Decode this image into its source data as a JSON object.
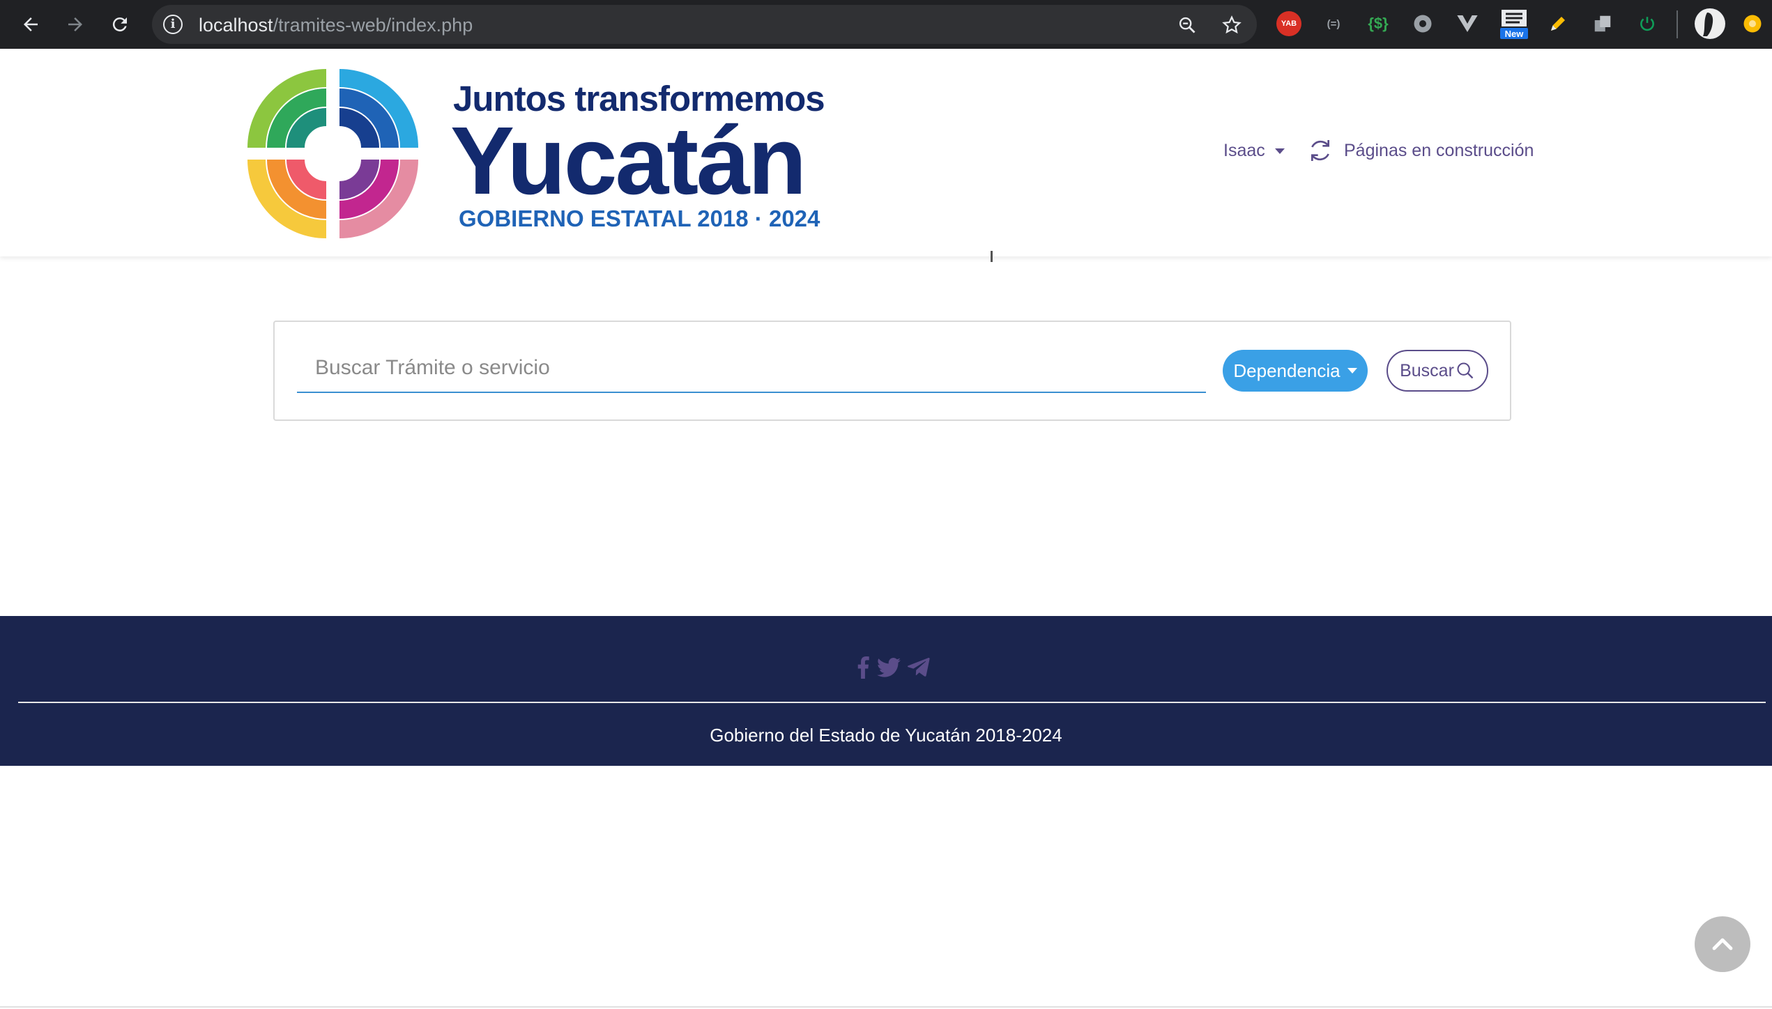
{
  "browser": {
    "url_host": "localhost",
    "url_path": "/tramites-web/index.php",
    "extensions": [
      {
        "name": "yab-extension",
        "label": "YAB",
        "color": "#d93025"
      },
      {
        "name": "json-extension",
        "label": "{=}",
        "color": "#5f6368"
      },
      {
        "name": "regex-extension",
        "label": "{$}",
        "color": "#188038"
      },
      {
        "name": "circle-extension",
        "label": "",
        "color": "#9aa0a6"
      },
      {
        "name": "vue-extension",
        "label": "V",
        "color": "#9aa0a6"
      },
      {
        "name": "new-extension",
        "label": "New",
        "color": "#1a73e8"
      },
      {
        "name": "pencil-extension",
        "label": "",
        "color": "#fbbc04"
      },
      {
        "name": "copy-extension",
        "label": "",
        "color": "#9aa0a6"
      },
      {
        "name": "power-extension",
        "label": "",
        "color": "#0f9d58"
      }
    ]
  },
  "header": {
    "logo_line1": "Juntos transformemos",
    "logo_line2": "Yucatán",
    "logo_line3": "GOBIERNO ESTATAL 2018 · 2024",
    "user_name": "Isaac",
    "construction_link": "Páginas en construcción"
  },
  "search": {
    "placeholder": "Buscar Trámite o servicio",
    "value": "",
    "dependency_label": "Dependencia",
    "search_label": "Buscar"
  },
  "footer": {
    "social_icons": [
      "facebook-icon",
      "twitter-icon",
      "telegram-icon"
    ],
    "copyright": "Gobierno del Estado de Yucatán 2018-2024"
  },
  "colors": {
    "brand_navy": "#132a6e",
    "brand_blue": "#1f63b6",
    "accent_purple": "#5b4d8a",
    "button_blue": "#3aa0e6",
    "footer_bg": "#1b254e"
  }
}
